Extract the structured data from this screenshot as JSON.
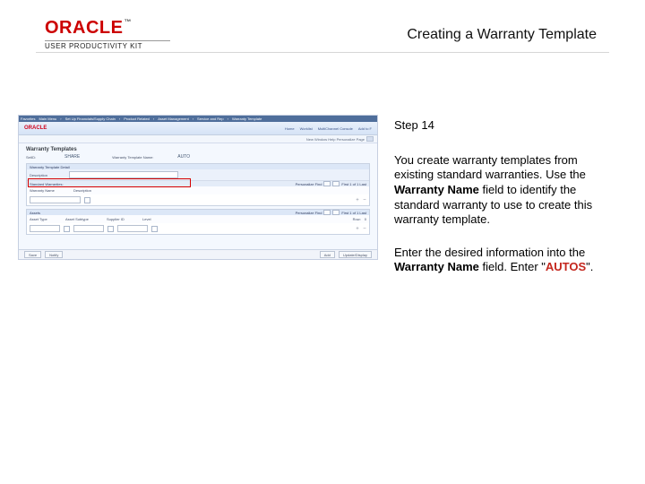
{
  "header": {
    "logo_main": "ORACLE",
    "logo_tm": "™",
    "logo_sub": "USER PRODUCTIVITY KIT",
    "page_title": "Creating a Warranty Template"
  },
  "instructions": {
    "step_label": "Step 14",
    "para1_a": "You create warranty templates from existing standard warranties. Use the ",
    "para1_b_bold": "Warranty Name",
    "para1_c": " field to identify the standard warranty to use to create this warranty template.",
    "para2_a": "Enter the desired information into the ",
    "para2_b_bold": "Warranty Name",
    "para2_c": " field. Enter \"",
    "para2_d_autos": "AUTOS",
    "para2_e": "\"."
  },
  "screenshot": {
    "top_menu": [
      "Favorites",
      "Main Menu",
      "Set Up Financials/Supply Chain",
      "Product Related",
      "Asset Management",
      "Service and Rep",
      "Warranty Template"
    ],
    "brand": "ORACLE",
    "tabs": [
      "Home",
      "Worklist",
      "MultiChannel Console",
      "Add to F"
    ],
    "subbar_text": "New Window  Help  Personalize Page",
    "h1": "Warranty Templates",
    "setid_label": "SetID:",
    "setid_value": "SHARE",
    "template_label": "Warranty Template Name:",
    "template_value": "AUTO",
    "panel1_title": "Warranty Template Detail",
    "std_label": "Standard Warranties:",
    "warranty_name_label": "Warranty Name",
    "desc_label": "Description",
    "personalize": "Personalize  Find",
    "nav_text": "First  1 of 1  Last",
    "panel2_title": "Assets",
    "asset_cols": [
      "Asset Type",
      "Asset Subtype",
      "Supplier ID",
      "Level"
    ],
    "row_label": "Row:",
    "row_value": "0",
    "btn_save": "Save",
    "btn_notify": "Notify",
    "btn_add": "Add",
    "btn_update": "Update/Display"
  }
}
